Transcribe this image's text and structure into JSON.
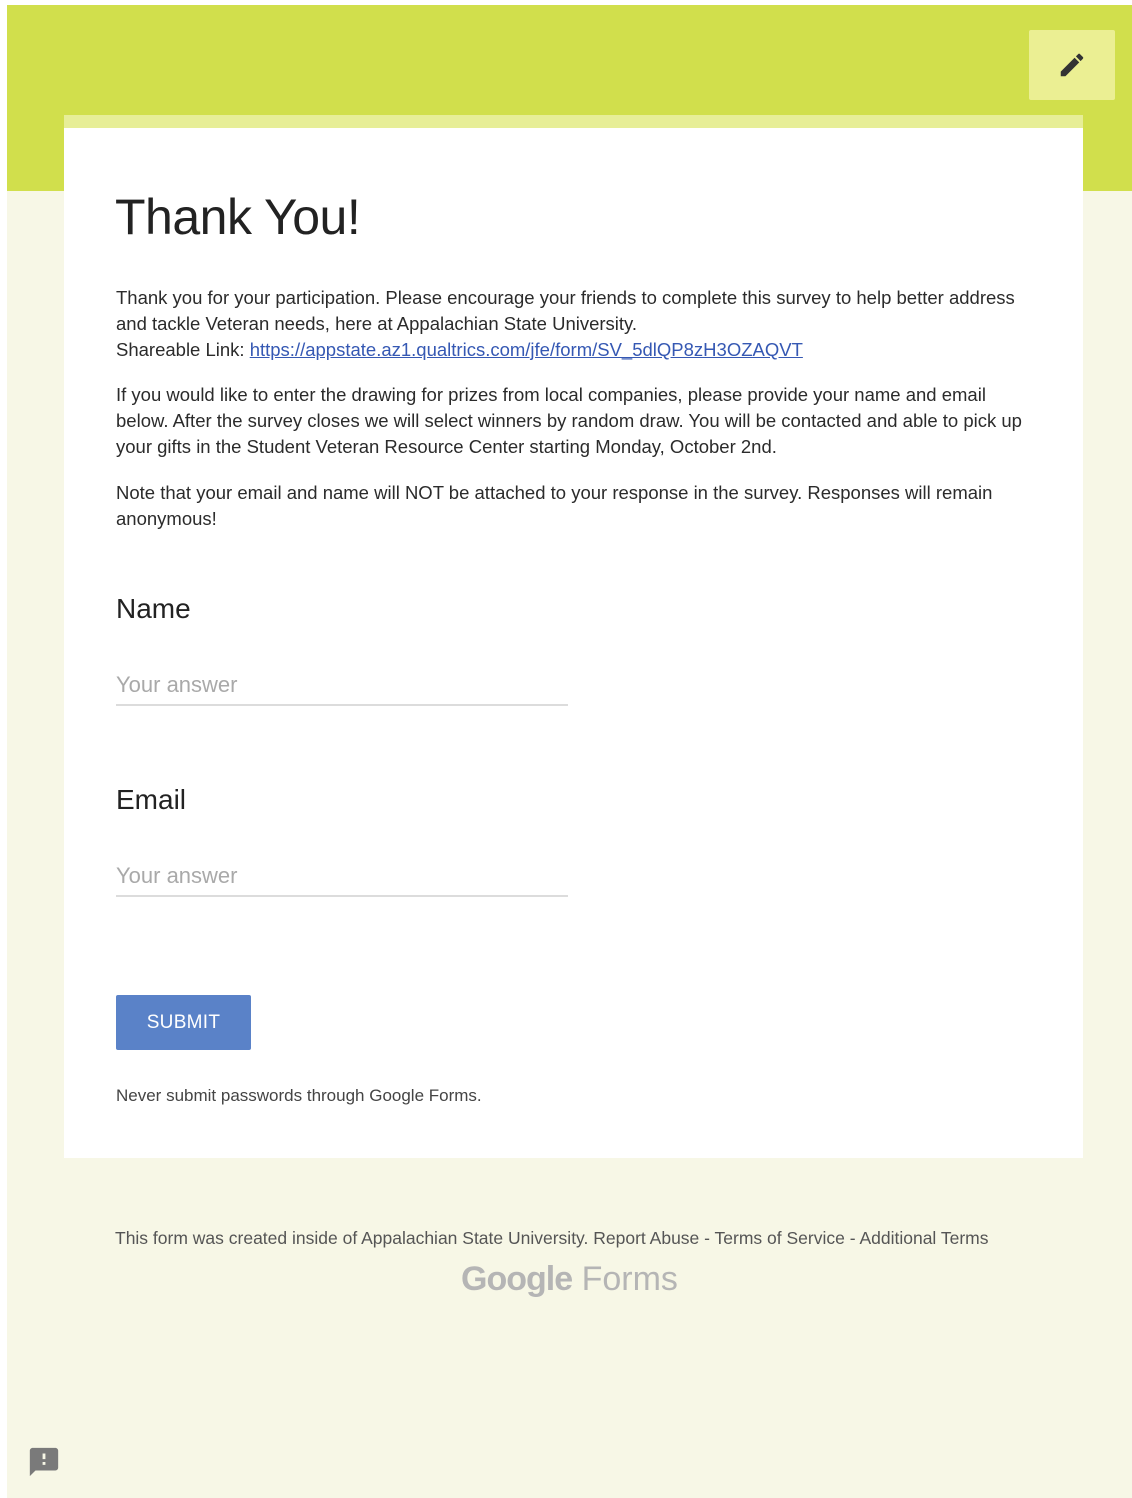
{
  "header": {
    "accent_color": "#d1df4c",
    "edit_icon": "pencil-icon"
  },
  "form": {
    "title": "Thank You!",
    "description": {
      "p1": "Thank you for your participation. Please encourage your friends to complete this survey to help better address and tackle Veteran needs, here at Appalachian State University.",
      "shareable_label": "Shareable Link: ",
      "shareable_url": "https://appstate.az1.qualtrics.com/jfe/form/SV_5dlQP8zH3OZAQVT",
      "p2": "If you would like to enter the drawing for prizes from local companies, please provide your name and email below. After the survey closes we will select winners by random draw. You will be contacted and able to pick up your gifts in the Student Veteran Resource Center starting Monday, October 2nd.",
      "p3": "Note that your email and name will NOT be attached to your response in the survey. Responses will remain anonymous!"
    },
    "questions": [
      {
        "label": "Name",
        "placeholder": "Your answer",
        "value": ""
      },
      {
        "label": "Email",
        "placeholder": "Your answer",
        "value": ""
      }
    ],
    "submit_label": "SUBMIT",
    "submit_color": "#5a82c8",
    "warning": "Never submit passwords through Google Forms."
  },
  "footer": {
    "notice": "This form was created inside of Appalachian State University.",
    "report_abuse": "Report Abuse",
    "separator": " - ",
    "terms_of_service": "Terms of Service",
    "additional_terms": "Additional Terms",
    "brand_google": "Google",
    "brand_forms": "Forms"
  },
  "feedback_icon": "report-feedback-icon"
}
